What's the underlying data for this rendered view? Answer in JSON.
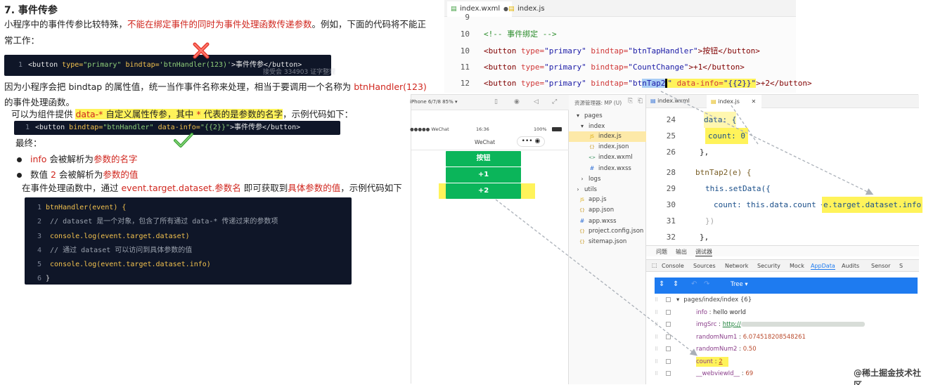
{
  "article": {
    "heading": "7. 事件传参",
    "intro_1": "小程序中的事件传参比较特殊，",
    "intro_red": "不能在绑定事件的同时为事件处理函数传递参数",
    "intro_2": "。例如，下面的代码将不能正",
    "intro_3": "常工作：",
    "bad_code": {
      "ln": "1",
      "p1": "<button ",
      "a1": "type=",
      "s1": "\"primary\" ",
      "a2": "bindtap=",
      "s2": "'btnHandler(123)'",
      "p2": ">事件传参</button>"
    },
    "watermark": "接受会 334903 证字整理",
    "reason_1": "因为小程序会把 bindtap 的属性值，统一当作事件名称来处理，相当于要调用一个名称为 ",
    "reason_red": "btnHandler(123)",
    "reason_2": "的事件处理函数。",
    "solution_1": "可以为组件提供 ",
    "solution_red1": "data-*",
    "solution_2": " 自定义属性传参，其中 ",
    "solution_red2": "*",
    "solution_3": " 代表的是参数的名字",
    "solution_4": "，示例代码如下：",
    "good_code": {
      "ln": "1",
      "p1": "<button ",
      "a1": "bindtap=",
      "s1": "\"btnHandler\" ",
      "a2": "data-info=",
      "s2": "\"{{2}}\"",
      "p2": ">事件传参</button>"
    },
    "finally": "最终：",
    "bullet1_red": "info",
    "bullet1_1": " 会被解析为",
    "bullet1_red2": "参数的名字",
    "bullet2_1": "数值 ",
    "bullet2_red": "2",
    "bullet2_2": " 会被解析为",
    "bullet2_red2": "参数的值",
    "handler_1": "在事件处理函数中，通过 ",
    "handler_red": "event.target.dataset.参数名",
    "handler_2": " 即可获取到",
    "handler_red2": "具体参数的值",
    "handler_3": "，示例代码如下",
    "code_lines": [
      {
        "n": "1",
        "t": "btnHandler(event) {"
      },
      {
        "n": "2",
        "t": "  // dataset 是一个对象，包含了所有通过 data-* 传递过来的参数项"
      },
      {
        "n": "3",
        "t": "  console.log(event.target.dataset)"
      },
      {
        "n": "4",
        "t": "  // 通过 dataset 可以访问到具体参数的值"
      },
      {
        "n": "5",
        "t": "  console.log(event.target.dataset.info)"
      },
      {
        "n": "6",
        "t": "}"
      }
    ]
  },
  "top_editor": {
    "tab1": "index.wxml",
    "tab2": "index.js",
    "lines": [
      {
        "n": "9",
        "t": ""
      },
      {
        "n": "10",
        "t": "<!-- 事件绑定 -->"
      },
      {
        "n": "11",
        "t": ""
      },
      {
        "n": "12",
        "t": ""
      }
    ],
    "l10_tag": "<button ",
    "l10_a1": "type=",
    "l10_v1": "\"primary\" ",
    "l10_a2": "bindtap=",
    "l10_v2": "\"btnTapHandler\"",
    "l10_rest": ">按钮</button>",
    "l11_v2": "\"CountChange\"",
    "l11_rest": ">+1</button>",
    "l12_v2a": "\"bt",
    "l12_v2b": "nTap2",
    "l12_v2c": "\" ",
    "l12_a3": "data-info=",
    "l12_v3": "\"{{2}}\"",
    "l12_rest": ">+2</button>",
    "nums": [
      "9",
      "10",
      "11",
      "12"
    ],
    "comment": "<!-- 事件绑定 -->"
  },
  "simulator": {
    "device": "iPhone 6/7/8 85% ▾",
    "carrier": "●●●●● WeChat",
    "time": "16:36",
    "battery": "100%",
    "nav_title": "WeChat",
    "buttons": [
      "按钮",
      "+1",
      "+2"
    ]
  },
  "explorer": {
    "title": "资源管理器: MP (U)",
    "items": [
      {
        "label": "pages",
        "indent": 0,
        "icon": "▾"
      },
      {
        "label": "index",
        "indent": 1,
        "icon": "▾"
      },
      {
        "label": "index.js",
        "indent": 2,
        "icon": "JS"
      },
      {
        "label": "index.json",
        "indent": 2,
        "icon": "{}"
      },
      {
        "label": "index.wxml",
        "indent": 2,
        "icon": "<>"
      },
      {
        "label": "index.wxss",
        "indent": 2,
        "icon": "#"
      },
      {
        "label": "logs",
        "indent": 1,
        "icon": "›"
      },
      {
        "label": "utils",
        "indent": 0,
        "icon": "›"
      },
      {
        "label": "app.js",
        "indent": 0,
        "icon": "JS"
      },
      {
        "label": "app.json",
        "indent": 0,
        "icon": "{}"
      },
      {
        "label": "app.wxss",
        "indent": 0,
        "icon": "#"
      },
      {
        "label": "project.config.json",
        "indent": 0,
        "icon": "{}"
      },
      {
        "label": "sitemap.json",
        "indent": 0,
        "icon": "{}"
      }
    ]
  },
  "code_editor": {
    "tab1": "index.wxml",
    "tab2": "index.js",
    "lines": [
      {
        "n": "24",
        "t": "data: {"
      },
      {
        "n": "25",
        "t": "count: 0"
      },
      {
        "n": "26",
        "t": "},"
      },
      {
        "n": "28",
        "t": "btnTap2(e) {"
      },
      {
        "n": "29",
        "t": "this.setData({"
      },
      {
        "n": "30",
        "t": "count: this.data.count + "
      },
      {
        "n": "31",
        "t": "})"
      },
      {
        "n": "32",
        "t": "},"
      }
    ],
    "highlight": "e.target.dataset.info"
  },
  "devtools": {
    "panel_tabs": [
      "问题",
      "输出",
      "调试器"
    ],
    "tabs": [
      "Console",
      "Sources",
      "Network",
      "Security",
      "Mock",
      "AppData",
      "Audits",
      "Sensor",
      "S"
    ],
    "active_tab": "AppData",
    "toolbar_label": "Tree ▾",
    "tree_root": "pages/index/index {6}",
    "rows": [
      {
        "k": "info",
        "v": "hello world"
      },
      {
        "k": "imgSrc",
        "v": "http://"
      },
      {
        "k": "randomNum1",
        "v": "6.074518208548261"
      },
      {
        "k": "randomNum2",
        "v": "0.50"
      },
      {
        "k": "count",
        "v": "2"
      },
      {
        "k": "__webviewId__",
        "v": "69"
      }
    ]
  },
  "footer_watermark": "@稀土掘金技术社区",
  "colors": {
    "accent_red": "#d0261e",
    "highlight": "#fff35a",
    "wechat_green": "#0bb55a",
    "devtools_blue": "#1e7bf0"
  }
}
